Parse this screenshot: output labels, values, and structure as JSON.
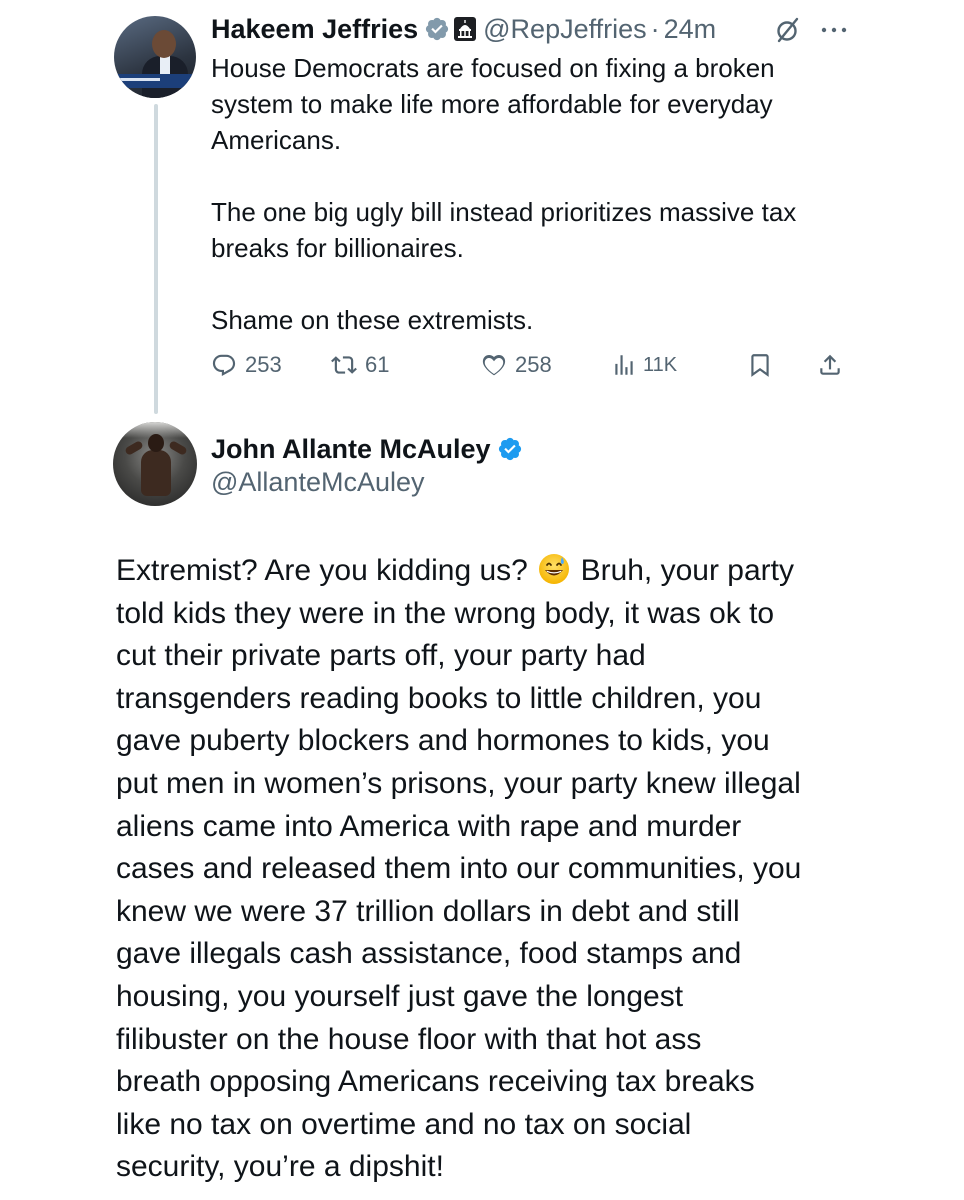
{
  "tweet1": {
    "author": {
      "display_name": "Hakeem Jeffries",
      "handle": "@RepJeffries",
      "verified_badge_color": "#1d9bf0",
      "affiliation_badge": "capitol-building-icon"
    },
    "time_separator": "·",
    "time": "24m",
    "paragraphs": [
      [
        "House Democrats are focused on fixing a broken",
        "system to make life more affordable for everyday",
        "Americans."
      ],
      [
        "The one big ugly bill instead prioritizes massive tax",
        "breaks for billionaires."
      ],
      [
        "Shame on these extremists."
      ]
    ],
    "metrics": {
      "replies": "253",
      "reposts": "61",
      "likes": "258",
      "views": "11K"
    }
  },
  "tweet2": {
    "author": {
      "display_name": "John Allante McAuley",
      "handle": "@AllanteMcAuley",
      "verified_badge_color": "#1d9bf0"
    },
    "lines": [
      "Extremist? Are you kidding us?",
      "Bruh, your party",
      "told kids they were in the wrong body, it was ok to",
      "cut their private parts off, your party had",
      "transgenders reading books to little children, you",
      "gave puberty blockers and hormones to kids, you",
      "put men in women’s prisons, your party knew illegal",
      "aliens came into America with rape and murder",
      "cases and released them into our communities, you",
      "knew we were 37 trillion dollars in debt and still",
      "gave illegals cash assistance, food stamps and",
      "housing, you yourself just gave the longest",
      "filibuster on the house floor with that hot ass",
      "breath opposing Americans receiving tax breaks",
      "like no tax on overtime and no tax on social",
      "security, you’re a dipshit!"
    ],
    "emoji": "grinning-sweat-emoji"
  },
  "colors": {
    "text_primary": "#0f1419",
    "text_secondary": "#536471",
    "thread_line": "#cfd9de",
    "verified_blue": "#1d9bf0"
  }
}
